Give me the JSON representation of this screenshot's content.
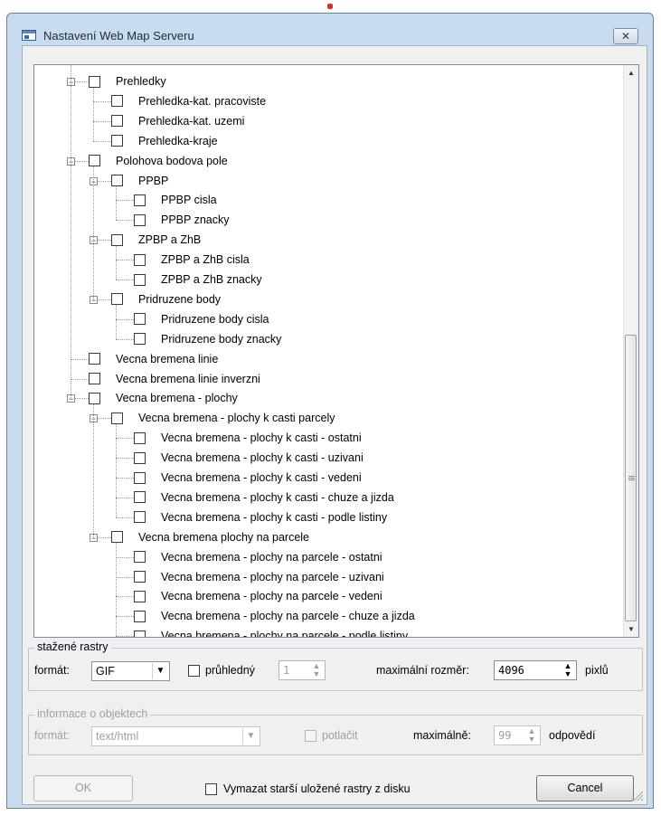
{
  "window": {
    "title": "Nastavení Web Map Serveru",
    "close_glyph": "✕"
  },
  "tree": {
    "items": [
      {
        "label": "Prehledky",
        "depth": 0,
        "expander": "minus"
      },
      {
        "label": "Prehledka-kat. pracoviste",
        "depth": 1
      },
      {
        "label": "Prehledka-kat. uzemi",
        "depth": 1
      },
      {
        "label": "Prehledka-kraje",
        "depth": 1
      },
      {
        "label": "Polohova bodova pole",
        "depth": 0,
        "expander": "minus"
      },
      {
        "label": "PPBP",
        "depth": 1,
        "expander": "minus"
      },
      {
        "label": "PPBP cisla",
        "depth": 2
      },
      {
        "label": "PPBP znacky",
        "depth": 2
      },
      {
        "label": "ZPBP a ZhB",
        "depth": 1,
        "expander": "minus"
      },
      {
        "label": "ZPBP a ZhB cisla",
        "depth": 2
      },
      {
        "label": "ZPBP a ZhB znacky",
        "depth": 2
      },
      {
        "label": "Pridruzene body",
        "depth": 1,
        "expander": "minus"
      },
      {
        "label": "Pridruzene body cisla",
        "depth": 2
      },
      {
        "label": "Pridruzene body znacky",
        "depth": 2
      },
      {
        "label": "Vecna bremena linie",
        "depth": 0
      },
      {
        "label": "Vecna bremena linie inverzni",
        "depth": 0
      },
      {
        "label": "Vecna bremena - plochy",
        "depth": 0,
        "expander": "minus"
      },
      {
        "label": "Vecna bremena - plochy k casti parcely",
        "depth": 1,
        "expander": "minus"
      },
      {
        "label": "Vecna bremena - plochy k casti - ostatni",
        "depth": 2
      },
      {
        "label": "Vecna bremena - plochy k casti - uzivani",
        "depth": 2
      },
      {
        "label": "Vecna bremena - plochy k casti - vedeni",
        "depth": 2
      },
      {
        "label": "Vecna bremena - plochy k casti - chuze a jizda",
        "depth": 2
      },
      {
        "label": "Vecna bremena - plochy k casti - podle listiny",
        "depth": 2
      },
      {
        "label": "Vecna bremena plochy na parcele",
        "depth": 1,
        "expander": "minus"
      },
      {
        "label": "Vecna bremena - plochy na parcele - ostatni",
        "depth": 2
      },
      {
        "label": "Vecna bremena - plochy na parcele - uzivani",
        "depth": 2
      },
      {
        "label": "Vecna bremena - plochy na parcele - vedeni",
        "depth": 2
      },
      {
        "label": "Vecna bremena - plochy na parcele - chuze a jizda",
        "depth": 2
      },
      {
        "label": "Vecna bremena - plochy na parcele - podle listiny",
        "depth": 2
      }
    ],
    "scroll": {
      "up_glyph": "▲",
      "down_glyph": "▼",
      "thumb_start_fraction": 0.47,
      "thumb_end_fraction": 1.0
    }
  },
  "rasters": {
    "legend": "stažené rastry",
    "format_label": "formát:",
    "format_value": "GIF",
    "transparent_label": "průhledný",
    "transparent_checked": false,
    "transparency_value": "1",
    "max_size_label": "maximální rozměr:",
    "max_size_value": "4096",
    "unit": "pixlů"
  },
  "objects": {
    "legend": "informace o objektech",
    "format_label": "formát:",
    "format_value": "text/html",
    "suppress_label": "potlačit",
    "suppress_checked": false,
    "max_label": "maximálně:",
    "max_value": "99",
    "unit": "odpovědí"
  },
  "footer": {
    "ok_label": "OK",
    "delete_old_label": "Vymazat starší uložené rastry z disku",
    "delete_old_checked": false,
    "cancel_label": "Cancel"
  },
  "colors": {
    "window_frame": "#c9dcef",
    "client_bg": "#f0f0f0",
    "disabled_text": "#a0a0a0"
  }
}
